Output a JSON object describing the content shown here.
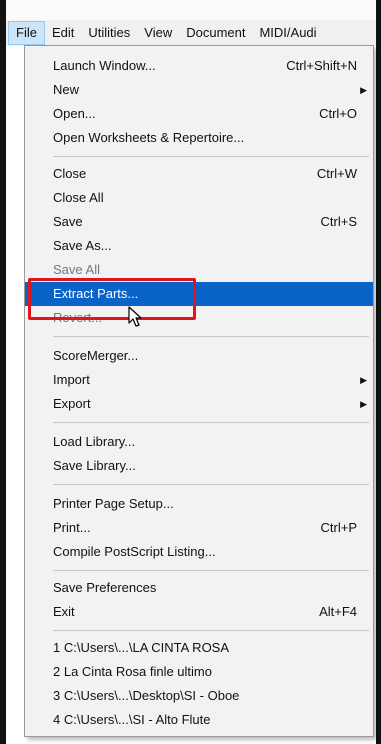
{
  "menubar": {
    "items": [
      "File",
      "Edit",
      "Utilities",
      "View",
      "Document",
      "MIDI/Audi"
    ]
  },
  "file_menu": {
    "items": [
      {
        "label": "Launch Window...",
        "shortcut": "Ctrl+Shift+N"
      },
      {
        "label": "New",
        "shortcut": ""
      },
      {
        "label": "Open...",
        "shortcut": "Ctrl+O"
      },
      {
        "label": "Open Worksheets & Repertoire...",
        "shortcut": ""
      },
      {
        "label": "Close",
        "shortcut": "Ctrl+W"
      },
      {
        "label": "Close All",
        "shortcut": ""
      },
      {
        "label": "Save",
        "shortcut": "Ctrl+S"
      },
      {
        "label": "Save As...",
        "shortcut": ""
      },
      {
        "label": "Save All",
        "shortcut": ""
      },
      {
        "label": "Extract Parts...",
        "shortcut": ""
      },
      {
        "label": "Revert...",
        "shortcut": ""
      },
      {
        "label": "ScoreMerger...",
        "shortcut": ""
      },
      {
        "label": "Import",
        "shortcut": ""
      },
      {
        "label": "Export",
        "shortcut": ""
      },
      {
        "label": "Load Library...",
        "shortcut": ""
      },
      {
        "label": "Save Library...",
        "shortcut": ""
      },
      {
        "label": "Printer Page Setup...",
        "shortcut": ""
      },
      {
        "label": "Print...",
        "shortcut": "Ctrl+P"
      },
      {
        "label": "Compile PostScript Listing...",
        "shortcut": ""
      },
      {
        "label": "Save Preferences",
        "shortcut": ""
      },
      {
        "label": "Exit",
        "shortcut": "Alt+F4"
      },
      {
        "label": "1 C:\\Users\\...\\LA CINTA ROSA",
        "shortcut": ""
      },
      {
        "label": "2 La Cinta Rosa finle ultimo",
        "shortcut": ""
      },
      {
        "label": "3 C:\\Users\\...\\Desktop\\SI - Oboe",
        "shortcut": ""
      },
      {
        "label": "4 C:\\Users\\...\\SI - Alto Flute",
        "shortcut": ""
      }
    ]
  },
  "icons": {
    "submenu_arrow": "submenu-arrow-icon",
    "mouse_cursor": "mouse-pointer-icon"
  },
  "colors": {
    "highlight": "#0a64c8",
    "annotation_box": "#e0141c",
    "menu_background": "#f2f2f2",
    "menubar_active": "#cce4f7"
  }
}
